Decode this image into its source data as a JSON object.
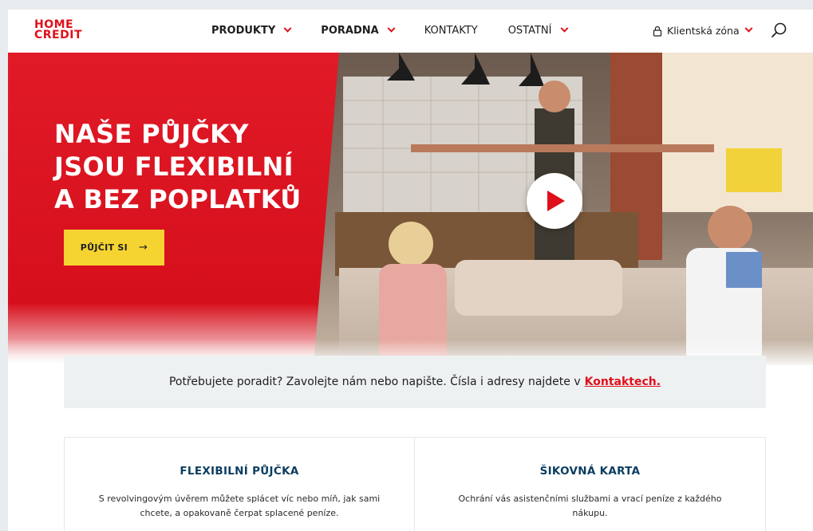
{
  "header": {
    "logo_line1": "HOME",
    "logo_line2": "CREDIT",
    "nav": [
      {
        "label": "PRODUKTY",
        "bold": true,
        "dropdown": true
      },
      {
        "label": "PORADNA",
        "bold": true,
        "dropdown": true
      },
      {
        "label": "KONTAKTY",
        "bold": false,
        "dropdown": false
      },
      {
        "label": "OSTATNÍ",
        "bold": false,
        "dropdown": true
      }
    ],
    "client_zone": "Klientská zóna"
  },
  "hero": {
    "title_line1": "NAŠE PŮJČKY",
    "title_line2": "JSOU FLEXIBILNÍ",
    "title_line3": "A BEZ POPLATKŮ",
    "cta_label": "PŮJČIT SI",
    "cta_arrow": "→"
  },
  "info": {
    "text": "Potřebujete poradit? Zavolejte nám nebo napište. Čísla i adresy najdete v",
    "link": "Kontaktech."
  },
  "cards": [
    {
      "title": "FLEXIBILNÍ PŮJČKA",
      "text": "S revolvingovým úvěrem můžete splácet víc nebo míň, jak sami chcete, a opakovaně čerpat splacené peníze."
    },
    {
      "title": "ŠIKOVNÁ KARTA",
      "text": "Ochrání vás asistenčními službami a vrací peníze z každého nákupu."
    }
  ],
  "colors": {
    "brand_red": "#e0101b",
    "cta_yellow": "#f5d432",
    "card_title": "#0b3d5f"
  }
}
